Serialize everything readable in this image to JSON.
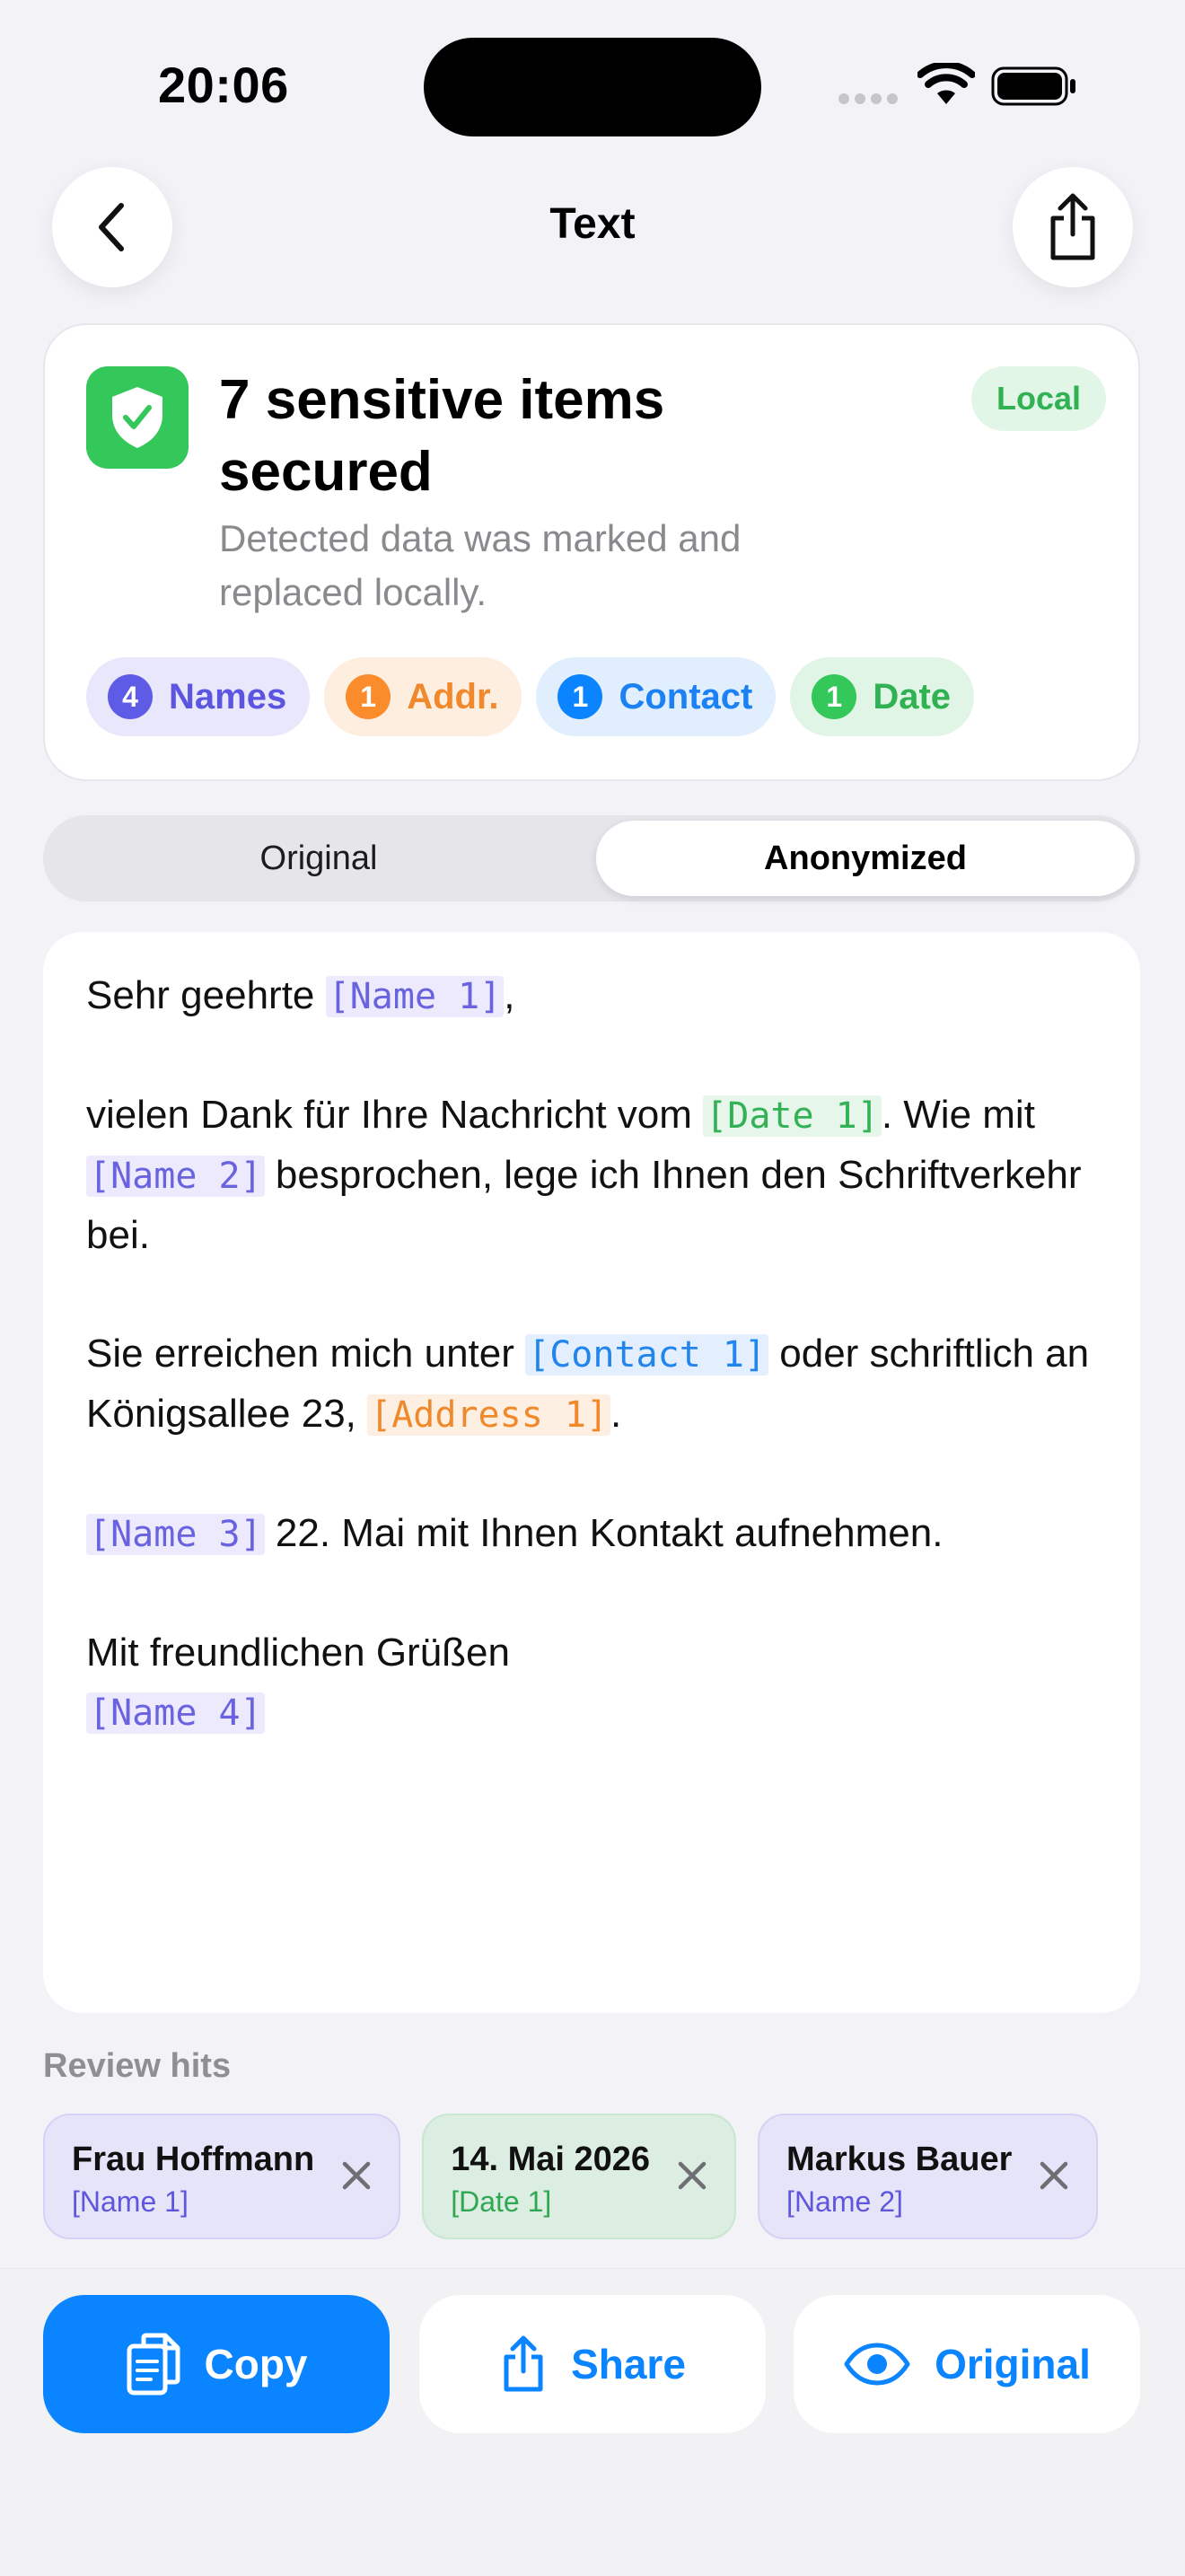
{
  "status": {
    "time": "20:06"
  },
  "nav": {
    "title": "Text"
  },
  "summary": {
    "title": "7 sensitive items secured",
    "subtitle": "Detected data was marked and replaced locally.",
    "badge": "Local",
    "chips": [
      {
        "count": "4",
        "label": "Names"
      },
      {
        "count": "1",
        "label": "Addr."
      },
      {
        "count": "1",
        "label": "Contact"
      },
      {
        "count": "1",
        "label": "Date"
      }
    ]
  },
  "segment": {
    "original": "Original",
    "anonymized": "Anonymized",
    "selected": "Anonymized"
  },
  "doc": {
    "p1_pre": "Sehr geehrte ",
    "p1_tag": "[Name 1]",
    "p1_post": ",",
    "p2_pre": "vielen Dank für Ihre Nachricht vom ",
    "p2_tag1": "[Date 1]",
    "p2_mid": ". Wie mit ",
    "p2_tag2": "[Name 2]",
    "p2_post": " besprochen, lege ich Ihnen den Schriftverkehr bei.",
    "p3_pre": "Sie erreichen mich unter ",
    "p3_tag1": "[Contact 1]",
    "p3_mid": " oder schriftlich an Königsallee 23, ",
    "p3_tag2": "[Address 1]",
    "p3_post": ".",
    "p4_tag": "[Name 3]",
    "p4_post": " 22. Mai mit Ihnen Kontakt aufnehmen.",
    "p5_text": "Mit freundlichen Grüßen",
    "p5_tag": "[Name 4]"
  },
  "review": {
    "label": "Review hits",
    "hits": [
      {
        "value": "Frau Hoffmann",
        "tag": "[Name 1]"
      },
      {
        "value": "14. Mai 2026",
        "tag": "[Date 1]"
      },
      {
        "value": "Markus Bauer",
        "tag": "[Name 2]"
      }
    ]
  },
  "actions": {
    "copy": "Copy",
    "share": "Share",
    "original": "Original"
  },
  "colors": {
    "accent": "#0a84ff",
    "success": "#34c759",
    "names": "#5e5ce6",
    "address": "#fb8c2b"
  },
  "icons": [
    "chevron-left-icon",
    "share-icon",
    "shield-check-icon",
    "close-icon",
    "copy-icon",
    "eye-icon"
  ]
}
